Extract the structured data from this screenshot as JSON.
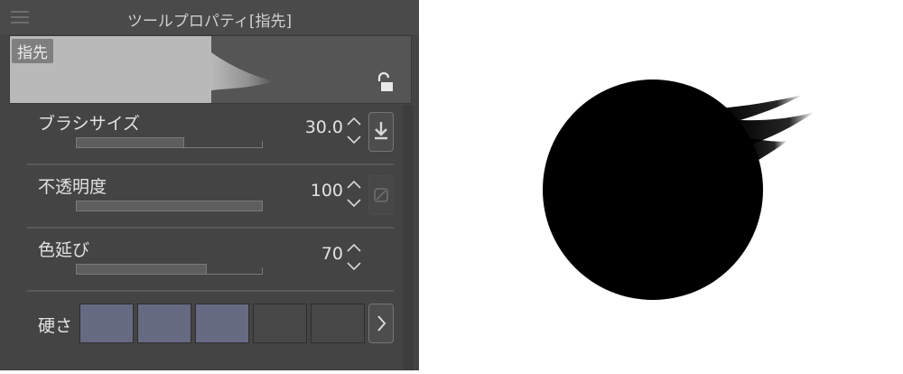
{
  "titlebar": {
    "title": "ツールプロパティ[指先]",
    "menu_icon": "hamburger-icon"
  },
  "preview": {
    "tool_name": "指先",
    "lock_icon": "unlock-icon"
  },
  "properties": {
    "brush_size": {
      "label": "ブラシサイズ",
      "value": "30.0",
      "fill_fraction": 0.58,
      "side_icon": "download-icon"
    },
    "opacity": {
      "label": "不透明度",
      "value": "100",
      "fill_fraction": 1.0,
      "side_icon": "slash-box-icon"
    },
    "color_stretch": {
      "label": "色延び",
      "value": "70",
      "fill_fraction": 0.7
    },
    "hardness": {
      "label": "硬さ",
      "levels_total": 5,
      "levels_selected": 3,
      "side_icon": "chevron-right-icon"
    }
  },
  "colors": {
    "panel_bg": "#444444",
    "hardness_selected": "#666a82",
    "hardness_unselected": "#474747"
  }
}
